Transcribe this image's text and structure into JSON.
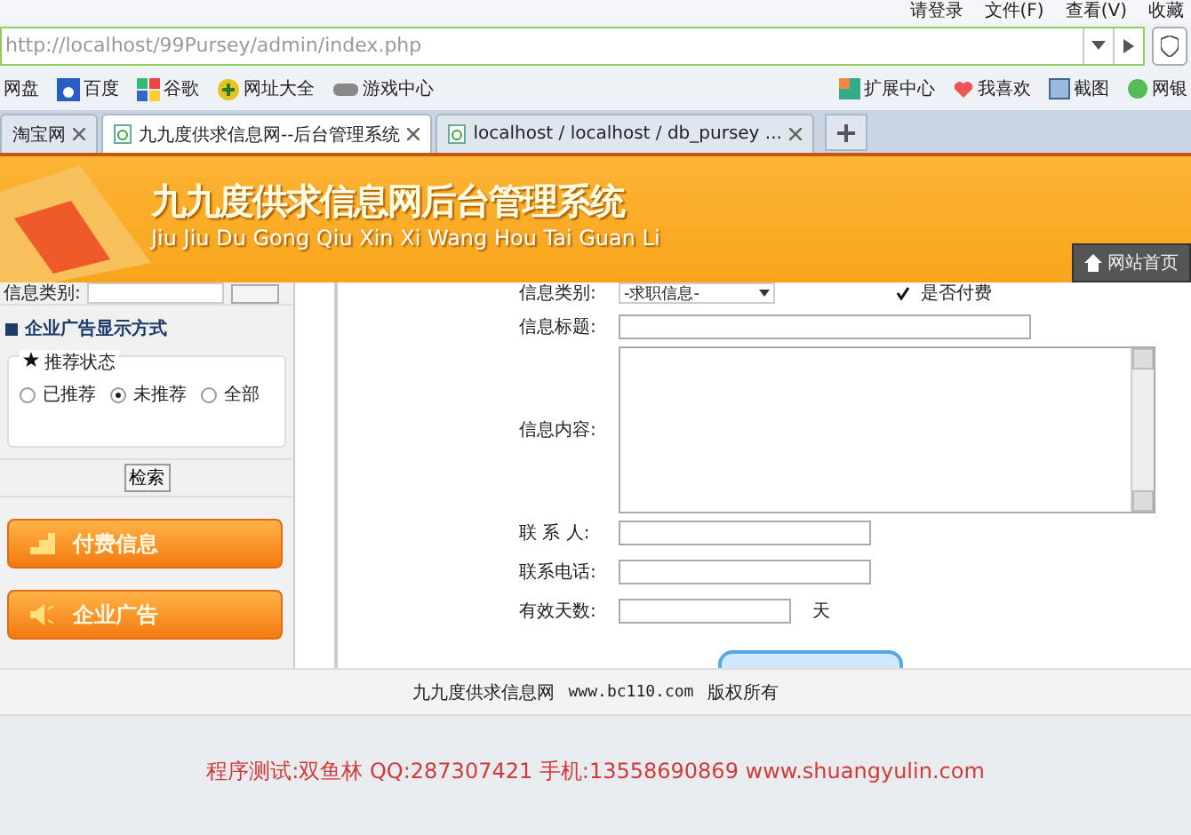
{
  "browser": {
    "menu": [
      "请登录",
      "文件(F)",
      "查看(V)",
      "收藏"
    ],
    "address": "http://localhost/99Pursey/admin/index.php",
    "bookmarks": [
      "网盘",
      "百度",
      "谷歌",
      "网址大全",
      "游戏中心"
    ],
    "bookmarks_right": [
      "扩展中心",
      "我喜欢",
      "截图",
      "网银"
    ],
    "tabs": [
      {
        "label": "淘宝网",
        "selected": false
      },
      {
        "label": "九九度供求信息网--后台管理系统",
        "selected": true
      },
      {
        "label": "localhost / localhost / db_pursey ...",
        "selected": false
      }
    ]
  },
  "banner": {
    "title": "九九度供求信息网后台管理系统",
    "subtitle": "Jiu Jiu Du Gong Qiu Xin Xi Wang Hou Tai Guan Li",
    "home_button": "网站首页"
  },
  "sidebar": {
    "top_label": "信息类别:",
    "section_title": "企业广告显示方式",
    "legend": "推荐状态",
    "radios": [
      {
        "label": "已推荐",
        "selected": false
      },
      {
        "label": "未推荐",
        "selected": true
      },
      {
        "label": "全部",
        "selected": false
      }
    ],
    "search_button": "检索",
    "menu": [
      "付费信息",
      "企业广告"
    ]
  },
  "form": {
    "category_label": "信息类别:",
    "category_value": "-求职信息-",
    "paid_label": "是否付费",
    "paid_checked": true,
    "title_label": "信息标题:",
    "content_label": "信息内容:",
    "contact_label": "联 系 人:",
    "phone_label": "联系电话:",
    "days_label": "有效天数:",
    "days_unit": "天"
  },
  "footer": {
    "site": "九九度供求信息网",
    "url": "www.bc110.com",
    "rights": "版权所有"
  },
  "note": "程序测试:双鱼林 QQ:287307421 手机:13558690869 www.shuangyulin.com"
}
